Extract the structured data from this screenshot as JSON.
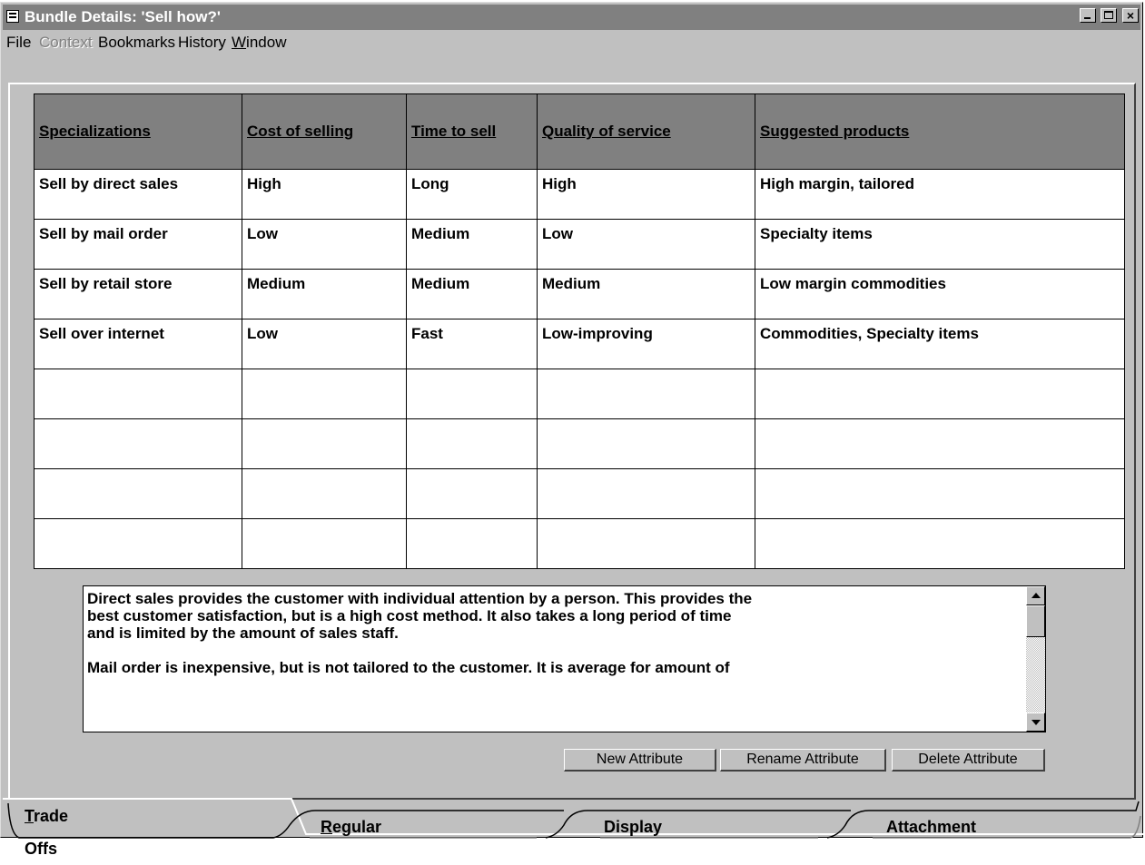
{
  "window": {
    "title": "Bundle Details: 'Sell how?'",
    "controls": {
      "minimize": "_",
      "maximize": "□",
      "close": "×"
    }
  },
  "menu": {
    "items": [
      "File",
      "Context",
      "Bookmarks",
      "History",
      "Window"
    ],
    "disabled": [
      "Context"
    ]
  },
  "table": {
    "headers": [
      "Specializations",
      "Cost of selling",
      "Time to sell",
      "Quality of service",
      "Suggested products"
    ],
    "rows": [
      [
        "Sell by direct sales",
        "High",
        "Long",
        "High",
        "High margin, tailored"
      ],
      [
        "Sell by mail order",
        "Low",
        "Medium",
        "Low",
        "Specialty items"
      ],
      [
        "Sell by retail store",
        "Medium",
        "Medium",
        "Medium",
        "Low margin commodities"
      ],
      [
        "Sell over internet",
        "Low",
        "Fast",
        "Low-improving",
        "Commodities, Specialty items"
      ],
      [
        "",
        "",
        "",
        "",
        ""
      ],
      [
        "",
        "",
        "",
        "",
        ""
      ],
      [
        "",
        "",
        "",
        "",
        ""
      ],
      [
        "",
        "",
        "",
        "",
        ""
      ]
    ]
  },
  "description": {
    "text": "Direct sales provides the customer with individual attention by a person. This provides the\nbest customer satisfaction, but is a high cost method. It also takes a long period of time\nand is limited by the amount of sales staff.\n\nMail order is inexpensive, but is not tailored to the customer. It is average for amount of"
  },
  "buttons": {
    "new_attribute": "New Attribute",
    "rename_attribute": "Rename Attribute",
    "delete_attribute": "Delete Attribute"
  },
  "tabs": [
    {
      "label": "Trade Offs",
      "active": true
    },
    {
      "label": "Regular",
      "active": false
    },
    {
      "label": "Display",
      "active": false
    },
    {
      "label": "Attachment",
      "active": false
    }
  ],
  "colors": {
    "face": "#c0c0c0",
    "header_bg": "#808080",
    "titlebar_inactive": "#808080"
  }
}
